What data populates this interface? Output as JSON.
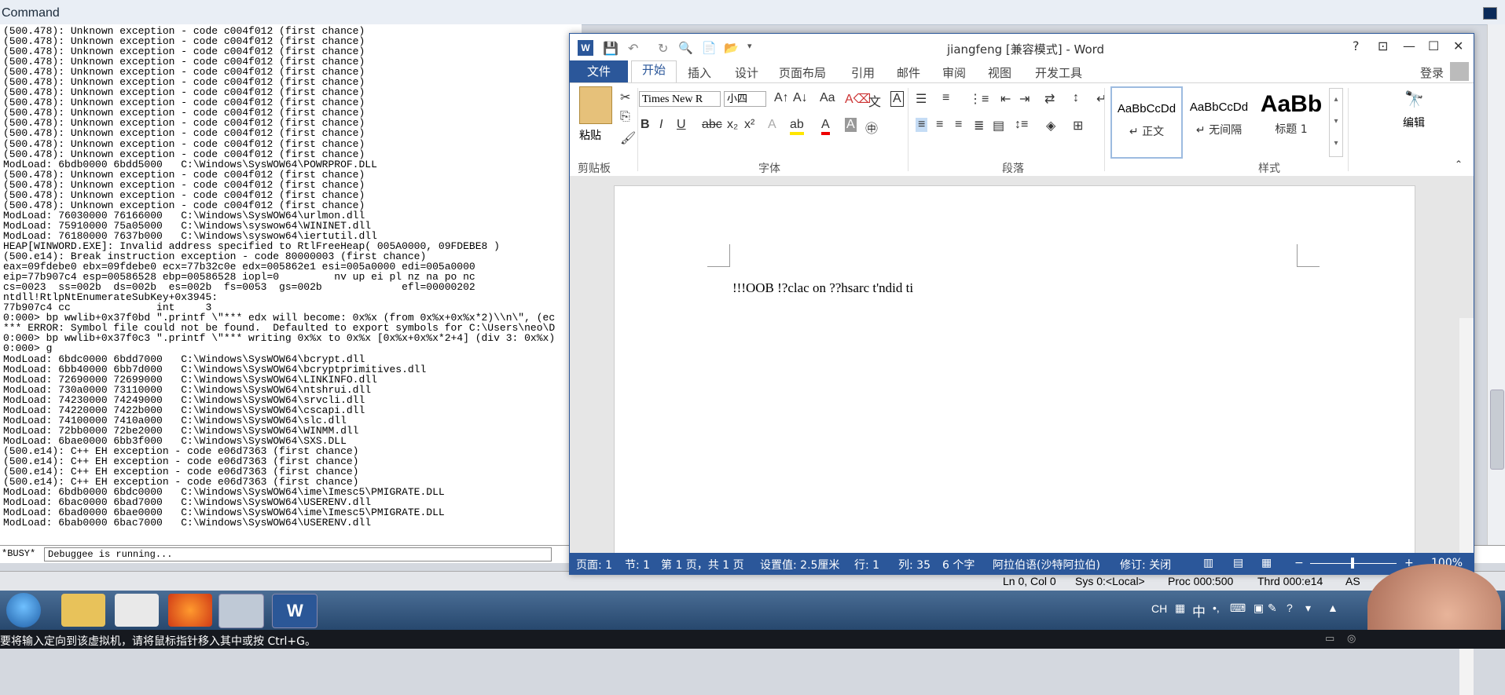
{
  "command_window": {
    "title": "Command",
    "log": [
      "(500.478): Unknown exception - code c004f012 (first chance)",
      "(500.478): Unknown exception - code c004f012 (first chance)",
      "(500.478): Unknown exception - code c004f012 (first chance)",
      "(500.478): Unknown exception - code c004f012 (first chance)",
      "(500.478): Unknown exception - code c004f012 (first chance)",
      "(500.478): Unknown exception - code c004f012 (first chance)",
      "(500.478): Unknown exception - code c004f012 (first chance)",
      "(500.478): Unknown exception - code c004f012 (first chance)",
      "(500.478): Unknown exception - code c004f012 (first chance)",
      "(500.478): Unknown exception - code c004f012 (first chance)",
      "(500.478): Unknown exception - code c004f012 (first chance)",
      "(500.478): Unknown exception - code c004f012 (first chance)",
      "(500.478): Unknown exception - code c004f012 (first chance)",
      "ModLoad: 6bdb0000 6bdd5000   C:\\Windows\\SysWOW64\\POWRPROF.DLL",
      "(500.478): Unknown exception - code c004f012 (first chance)",
      "(500.478): Unknown exception - code c004f012 (first chance)",
      "(500.478): Unknown exception - code c004f012 (first chance)",
      "(500.478): Unknown exception - code c004f012 (first chance)",
      "ModLoad: 76030000 76166000   C:\\Windows\\SysWOW64\\urlmon.dll",
      "ModLoad: 75910000 75a05000   C:\\Windows\\syswow64\\WININET.dll",
      "ModLoad: 76180000 7637b000   C:\\Windows\\syswow64\\iertutil.dll",
      "HEAP[WINWORD.EXE]: Invalid address specified to RtlFreeHeap( 005A0000, 09FDEBE8 )",
      "(500.e14): Break instruction exception - code 80000003 (first chance)",
      "eax=09fdebe0 ebx=09fdebe0 ecx=77b32c0e edx=005862e1 esi=005a0000 edi=005a0000",
      "eip=77b907c4 esp=00586528 ebp=00586528 iopl=0         nv up ei pl nz na po nc",
      "cs=0023  ss=002b  ds=002b  es=002b  fs=0053  gs=002b             efl=00000202",
      "ntdll!RtlpNtEnumerateSubKey+0x3945:",
      "77b907c4 cc              int     3",
      "0:000> bp wwlib+0x37f0bd \".printf \\\"*** edx will become: 0x%x (from 0x%x+0x%x*2)\\\\n\\\", (ec",
      "*** ERROR: Symbol file could not be found.  Defaulted to export symbols for C:\\Users\\neo\\D",
      "0:000> bp wwlib+0x37f0c3 \".printf \\\"*** writing 0x%x to 0x%x [0x%x+0x%x*2+4] (div 3: 0x%x)",
      "0:000> g",
      "ModLoad: 6bdc0000 6bdd7000   C:\\Windows\\SysWOW64\\bcrypt.dll",
      "ModLoad: 6bb40000 6bb7d000   C:\\Windows\\SysWOW64\\bcryptprimitives.dll",
      "ModLoad: 72690000 72699000   C:\\Windows\\SysWOW64\\LINKINFO.dll",
      "ModLoad: 730a0000 73110000   C:\\Windows\\SysWOW64\\ntshrui.dll",
      "ModLoad: 74230000 74249000   C:\\Windows\\SysWOW64\\srvcli.dll",
      "ModLoad: 74220000 7422b000   C:\\Windows\\SysWOW64\\cscapi.dll",
      "ModLoad: 74100000 7410a000   C:\\Windows\\SysWOW64\\slc.dll",
      "ModLoad: 72bb0000 72be2000   C:\\Windows\\SysWOW64\\WINMM.dll",
      "ModLoad: 6bae0000 6bb3f000   C:\\Windows\\SysWOW64\\SXS.DLL",
      "(500.e14): C++ EH exception - code e06d7363 (first chance)",
      "(500.e14): C++ EH exception - code e06d7363 (first chance)",
      "(500.e14): C++ EH exception - code e06d7363 (first chance)",
      "(500.e14): C++ EH exception - code e06d7363 (first chance)",
      "ModLoad: 6bdb0000 6bdc0000   C:\\Windows\\SysWOW64\\ime\\Imesc5\\PMIGRATE.DLL",
      "ModLoad: 6bac0000 6bad7000   C:\\Windows\\SysWOW64\\USERENV.dll",
      "ModLoad: 6bad0000 6bae0000   C:\\Windows\\SysWOW64\\ime\\Imesc5\\PMIGRATE.DLL",
      "ModLoad: 6bab0000 6bac7000   C:\\Windows\\SysWOW64\\USERENV.dll"
    ],
    "busy": "*BUSY*",
    "input_value": "Debuggee is running...",
    "status": {
      "pos": "Ln 0, Col 0",
      "sys": "Sys 0:<Local>",
      "proc": "Proc 000:500",
      "thrd": "Thrd 000:e14",
      "asm": "AS"
    }
  },
  "word": {
    "title": "jiangfeng [兼容模式] - Word",
    "window_controls": [
      "?",
      "⊡",
      "—",
      "☐",
      "✕"
    ],
    "tabs": [
      "文件",
      "开始",
      "插入",
      "设计",
      "页面布局",
      "引用",
      "邮件",
      "审阅",
      "视图",
      "开发工具"
    ],
    "signin": "登录",
    "font_name": "Times New R",
    "font_size": "小四",
    "groups": {
      "clipboard": "剪贴板",
      "font": "字体",
      "paragraph": "段落",
      "styles": "样式",
      "editing": "编辑"
    },
    "paste_label": "粘贴",
    "styles": [
      {
        "sample": "AaBbCcDd",
        "name": "↵ 正文"
      },
      {
        "sample": "AaBbCcDd",
        "name": "↵ 无间隔"
      },
      {
        "sample": "AaBb",
        "name": "标题 1"
      }
    ],
    "doc_text": "!!!OOB !?clac on ??hsarc t'ndid ti",
    "status": {
      "page": "页面: 1",
      "section": "节: 1",
      "pages": "第 1 页，共 1 页",
      "setting": "设置值: 2.5厘米",
      "row": "行: 1",
      "col": "列: 35",
      "chars": "6 个字",
      "lang": "阿拉伯语(沙特阿拉伯)",
      "revision": "修订: 关闭",
      "zoom": "100%"
    }
  },
  "taskbar": {
    "tray_text": "CH",
    "tray_ime": "中"
  },
  "vm_hint": "要将输入定向到该虚拟机，请将鼠标指针移入其中或按 Ctrl+G。"
}
